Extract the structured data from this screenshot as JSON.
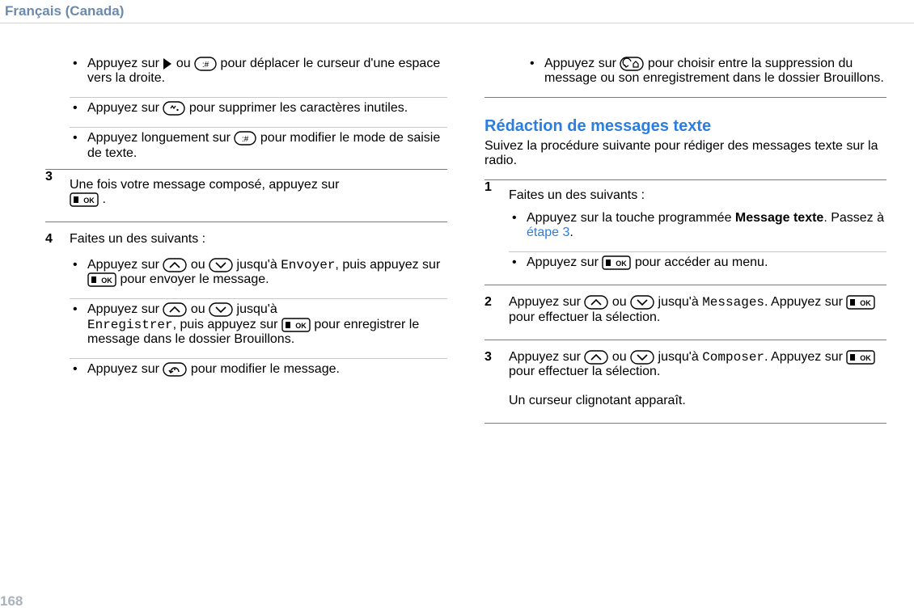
{
  "lang_header": "Français (Canada)",
  "page_number": "168",
  "col1": {
    "b_cursor_1": "Appuyez sur ",
    "b_cursor_2": " ou  ",
    "b_cursor_3": "  pour déplacer le curseur d'une espace vers la droite.",
    "b_del_1": "Appuyez sur  ",
    "b_del_2": "  pour supprimer les caractères inutiles.",
    "b_mode_1": "Appuyez longuement sur  ",
    "b_mode_2": "  pour modifier le mode de saisie de texte.",
    "s3_1": "Une fois votre message composé, appuyez sur ",
    "s3_2": " .",
    "s4_head": "Faites un des suivants :",
    "s4a_1": "Appuyez sur  ",
    "s4a_2": "  ou  ",
    "s4a_3": "  jusqu'à ",
    "s4a_m1": "Envoyer",
    "s4a_4": ", puis appuyez sur  ",
    "s4a_5": "  pour envoyer le message.",
    "s4b_1": "Appuyez sur  ",
    "s4b_2": "  ou  ",
    "s4b_3": "  jusqu'à ",
    "s4b_m1": "Enregistrer",
    "s4b_4": ", puis appuyez sur  ",
    "s4b_5": "  pour enregistrer le message dans le dossier Brouillons.",
    "s4c_1": "Appuyez sur  ",
    "s4c_2": "  pour modifier le message."
  },
  "col2": {
    "top_1": "Appuyez sur  ",
    "top_2": "  pour choisir entre la suppression du message ou son enregistrement dans le dossier Brouillons.",
    "heading": "Rédaction de messages texte",
    "intro": "Suivez la procédure suivante pour rédiger des messages texte sur la radio.",
    "s1_head": "Faites un des suivants :",
    "s1a_1": "Appuyez sur la touche programmée ",
    "s1a_bold": "Message texte",
    "s1a_2": ". Passez à ",
    "s1a_link": "étape 3",
    "s1a_3": ".",
    "s1b_1": "Appuyez sur  ",
    "s1b_2": "  pour accéder au menu.",
    "s2_1": "Appuyez sur  ",
    "s2_2": "  ou  ",
    "s2_3": "  jusqu'à ",
    "s2_m": "Messages",
    "s2_4": ". Appuyez sur  ",
    "s2_5": "  pour effectuer la sélection.",
    "s3_1": "Appuyez sur  ",
    "s3_2": "  ou  ",
    "s3_3": "  jusqu'à ",
    "s3_m": "Composer",
    "s3_4": ". Appuyez sur  ",
    "s3_5": "  pour effectuer la sélection.",
    "s3_6": "Un curseur clignotant apparaît."
  }
}
